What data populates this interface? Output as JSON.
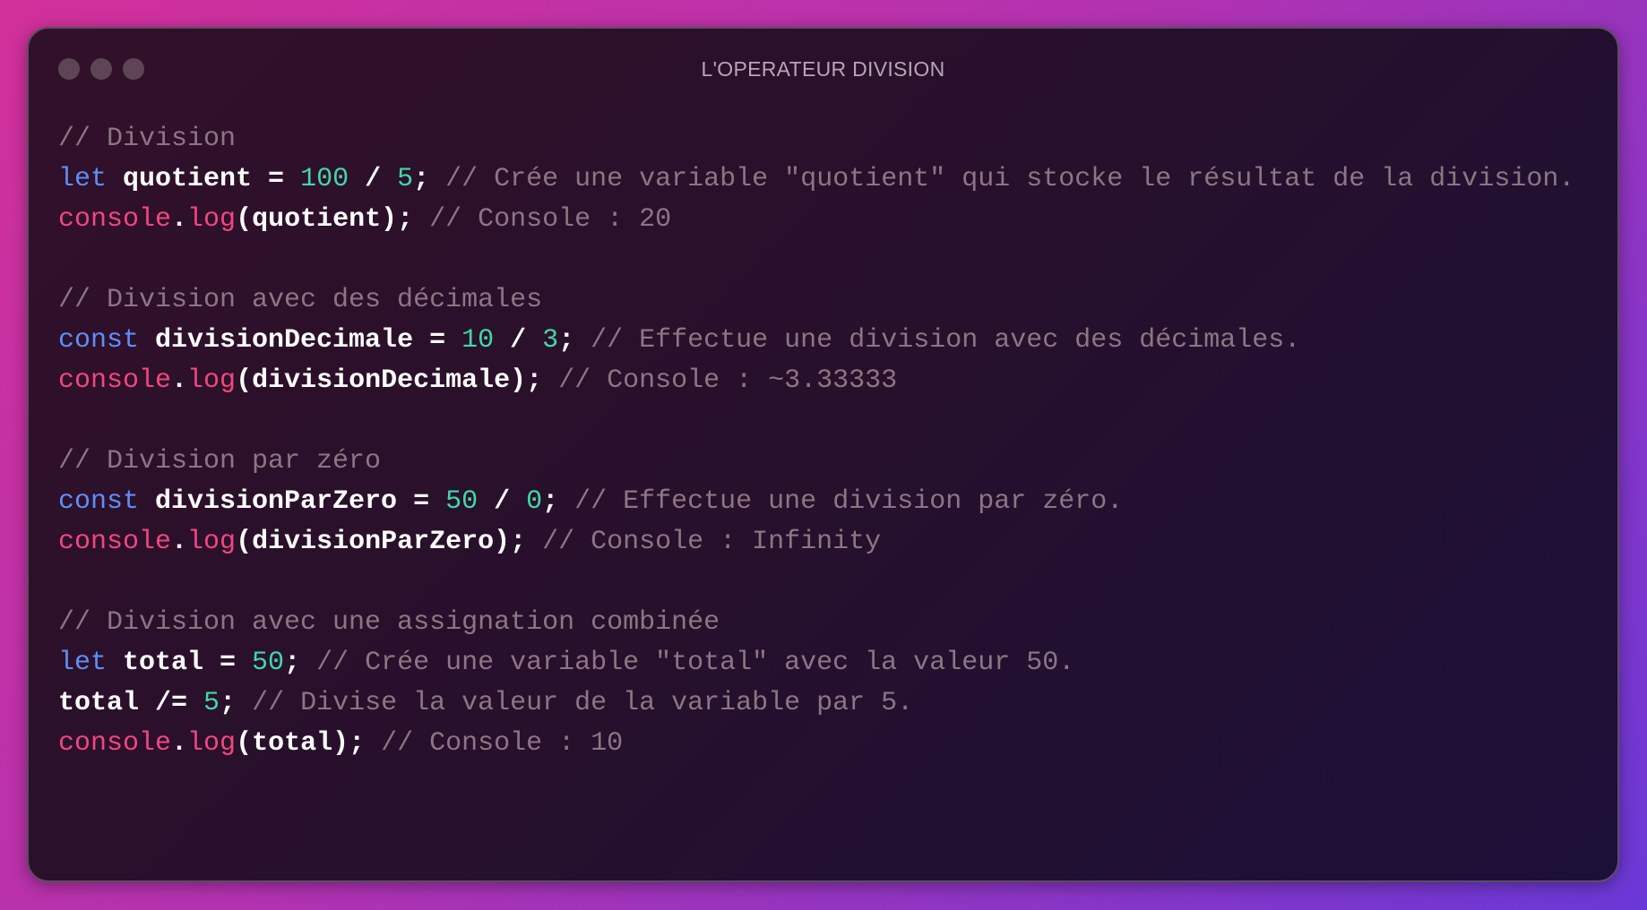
{
  "window": {
    "title": "L'OPERATEUR DIVISION"
  },
  "colors": {
    "keyword": "#5d8ff7",
    "number": "#3fd8a8",
    "function": "#f2467f",
    "comment": "#8c7683",
    "text": "#ffffff"
  },
  "lines": [
    [
      {
        "t": "cm",
        "v": "// Division"
      }
    ],
    [
      {
        "t": "kw",
        "v": "let"
      },
      {
        "t": "pl",
        "v": " quotient = "
      },
      {
        "t": "num",
        "v": "100"
      },
      {
        "t": "pl",
        "v": " / "
      },
      {
        "t": "num",
        "v": "5"
      },
      {
        "t": "pl",
        "v": "; "
      },
      {
        "t": "cm",
        "v": "// Crée une variable \"quotient\" qui stocke le résultat de la division."
      }
    ],
    [
      {
        "t": "fn",
        "v": "console"
      },
      {
        "t": "pl",
        "v": "."
      },
      {
        "t": "fn",
        "v": "log"
      },
      {
        "t": "pl",
        "v": "(quotient); "
      },
      {
        "t": "cm",
        "v": "// Console : 20"
      }
    ],
    [],
    [
      {
        "t": "cm",
        "v": "// Division avec des décimales"
      }
    ],
    [
      {
        "t": "kw",
        "v": "const"
      },
      {
        "t": "pl",
        "v": " divisionDecimale = "
      },
      {
        "t": "num",
        "v": "10"
      },
      {
        "t": "pl",
        "v": " / "
      },
      {
        "t": "num",
        "v": "3"
      },
      {
        "t": "pl",
        "v": "; "
      },
      {
        "t": "cm",
        "v": "// Effectue une division avec des décimales."
      }
    ],
    [
      {
        "t": "fn",
        "v": "console"
      },
      {
        "t": "pl",
        "v": "."
      },
      {
        "t": "fn",
        "v": "log"
      },
      {
        "t": "pl",
        "v": "(divisionDecimale); "
      },
      {
        "t": "cm",
        "v": "// Console : ~3.33333"
      }
    ],
    [],
    [
      {
        "t": "cm",
        "v": "// Division par zéro"
      }
    ],
    [
      {
        "t": "kw",
        "v": "const"
      },
      {
        "t": "pl",
        "v": " divisionParZero = "
      },
      {
        "t": "num",
        "v": "50"
      },
      {
        "t": "pl",
        "v": " / "
      },
      {
        "t": "num",
        "v": "0"
      },
      {
        "t": "pl",
        "v": "; "
      },
      {
        "t": "cm",
        "v": "// Effectue une division par zéro."
      }
    ],
    [
      {
        "t": "fn",
        "v": "console"
      },
      {
        "t": "pl",
        "v": "."
      },
      {
        "t": "fn",
        "v": "log"
      },
      {
        "t": "pl",
        "v": "(divisionParZero); "
      },
      {
        "t": "cm",
        "v": "// Console : Infinity"
      }
    ],
    [],
    [
      {
        "t": "cm",
        "v": "// Division avec une assignation combinée"
      }
    ],
    [
      {
        "t": "kw",
        "v": "let"
      },
      {
        "t": "pl",
        "v": " total = "
      },
      {
        "t": "num",
        "v": "50"
      },
      {
        "t": "pl",
        "v": "; "
      },
      {
        "t": "cm",
        "v": "// Crée une variable \"total\" avec la valeur 50."
      }
    ],
    [
      {
        "t": "pl",
        "v": "total /= "
      },
      {
        "t": "num",
        "v": "5"
      },
      {
        "t": "pl",
        "v": "; "
      },
      {
        "t": "cm",
        "v": "// Divise la valeur de la variable par 5."
      }
    ],
    [
      {
        "t": "fn",
        "v": "console"
      },
      {
        "t": "pl",
        "v": "."
      },
      {
        "t": "fn",
        "v": "log"
      },
      {
        "t": "pl",
        "v": "(total); "
      },
      {
        "t": "cm",
        "v": "// Console : 10"
      }
    ]
  ]
}
